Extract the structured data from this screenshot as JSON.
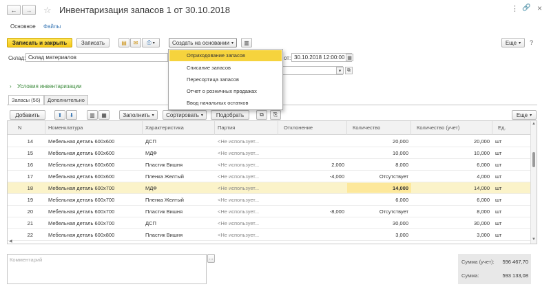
{
  "window": {
    "title": "Инвентаризация запасов 1 от 30.10.2018"
  },
  "nav_tabs": [
    "Основное",
    "Файлы"
  ],
  "toolbar": {
    "post_close": "Записать и закрыть",
    "save": "Записать",
    "create_based": "Создать на основании",
    "more": "Еще"
  },
  "header": {
    "warehouse_label": "Склад:",
    "warehouse_value": "Склад материалов",
    "date_label": "от:",
    "date_value": "30.10.2018 12:00:00"
  },
  "dropdown": {
    "items": [
      "Оприходование запасов",
      "Списание запасов",
      "Пересортица запасов",
      "Отчет о розничных продажах",
      "Ввод начальных остатков"
    ],
    "highlighted_index": 0
  },
  "conditions_link": "Условия инвентаризации",
  "tabs": [
    "Запасы (56)",
    "Дополнительно"
  ],
  "table_toolbar": {
    "add": "Добавить",
    "fill": "Заполнить",
    "sort": "Сортировать",
    "select": "Подобрать",
    "more": "Еще"
  },
  "table": {
    "columns": [
      "N",
      "Номенклатура",
      "Характеристика",
      "Партия",
      "Отклонение",
      "Количество",
      "Количество (учет)",
      "Ед."
    ],
    "rows": [
      {
        "n": "14",
        "item": "Мебельная деталь 600х600",
        "char": "ДСП",
        "batch": "<Не использует...",
        "dev": "",
        "qty": "20,000",
        "qty_acc": "20,000",
        "unit": "шт"
      },
      {
        "n": "15",
        "item": "Мебельная деталь 600х600",
        "char": "МДФ",
        "batch": "<Не использует...",
        "dev": "",
        "qty": "10,000",
        "qty_acc": "10,000",
        "unit": "шт"
      },
      {
        "n": "16",
        "item": "Мебельная деталь 600х600",
        "char": "Пластик Вишня",
        "batch": "<Не использует...",
        "dev": "2,000",
        "qty": "8,000",
        "qty_acc": "6,000",
        "unit": "шт"
      },
      {
        "n": "17",
        "item": "Мебельная деталь 600х600",
        "char": "Пленка Желтый",
        "batch": "<Не использует...",
        "dev": "-4,000",
        "qty": "Отсутствует",
        "qty_acc": "4,000",
        "unit": "шт"
      },
      {
        "n": "18",
        "item": "Мебельная деталь 600х700",
        "char": "МДФ",
        "batch": "<Не использует...",
        "dev": "",
        "qty": "14,000",
        "qty_acc": "14,000",
        "unit": "шт"
      },
      {
        "n": "19",
        "item": "Мебельная деталь 600х700",
        "char": "Пленка Желтый",
        "batch": "<Не использует...",
        "dev": "",
        "qty": "6,000",
        "qty_acc": "6,000",
        "unit": "шт"
      },
      {
        "n": "20",
        "item": "Мебельная деталь 600х700",
        "char": "Пластик Вишня",
        "batch": "<Не использует...",
        "dev": "-8,000",
        "qty": "Отсутствует",
        "qty_acc": "8,000",
        "unit": "шт"
      },
      {
        "n": "21",
        "item": "Мебельная деталь 600х700",
        "char": "ДСП",
        "batch": "<Не использует...",
        "dev": "",
        "qty": "30,000",
        "qty_acc": "30,000",
        "unit": "шт"
      },
      {
        "n": "22",
        "item": "Мебельная деталь 600х800",
        "char": "Пластик Вишня",
        "batch": "<Не использует...",
        "dev": "",
        "qty": "3,000",
        "qty_acc": "3,000",
        "unit": "шт"
      }
    ],
    "selected_row_index": 4
  },
  "comment": {
    "placeholder": "Комментарий"
  },
  "totals": {
    "sum_acc_label": "Сумма (учет):",
    "sum_acc_value": "596 467,70",
    "sum_label": "Сумма:",
    "sum_value": "593 133,08"
  },
  "colors": {
    "accent": "#f6d33d",
    "link": "#3b78b5",
    "selected_row": "#fbf3c9"
  },
  "icons": [
    "back-arrow-icon",
    "forward-arrow-icon",
    "star-icon",
    "more-vert-icon",
    "link-icon",
    "close-icon",
    "calendar-icon",
    "print-icon",
    "mail-icon",
    "doc-icon",
    "up-arrow-icon",
    "down-arrow-icon"
  ]
}
